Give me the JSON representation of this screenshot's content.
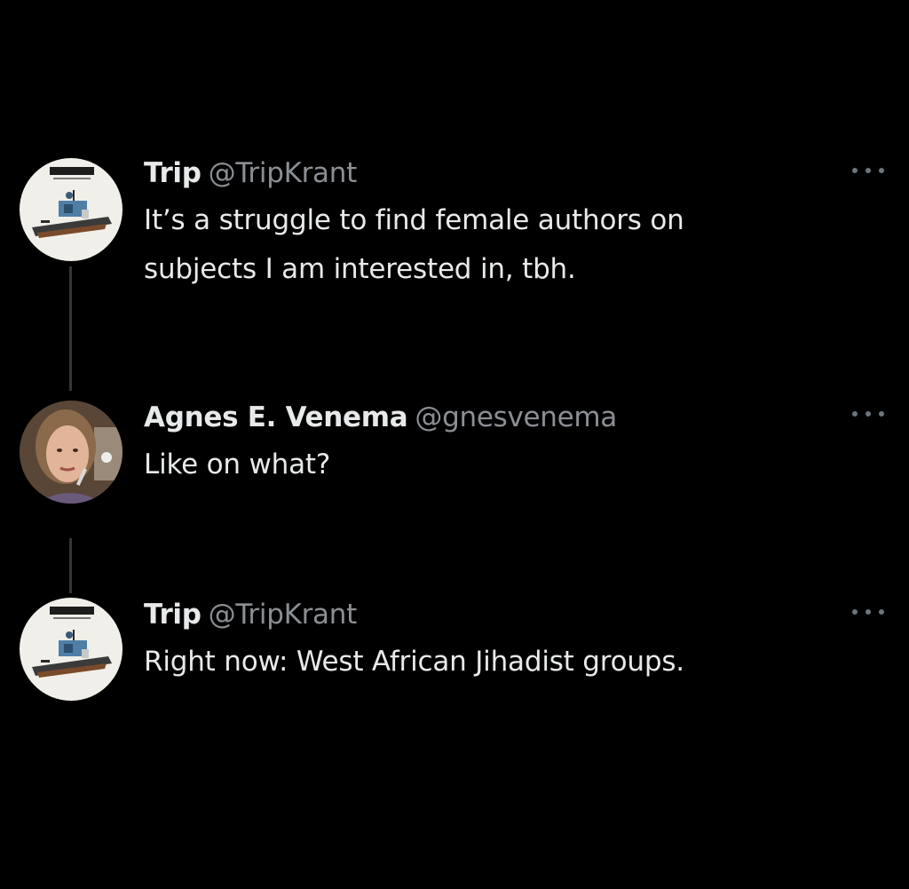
{
  "thread": {
    "tweets": [
      {
        "display_name": "Trip",
        "handle": "@TripKrant",
        "text": "It’s a struggle to find female authors on\nsubjects I am interested in, tbh.",
        "avatar": "book-cover-avatar",
        "more_icon": "more-dots-icon"
      },
      {
        "display_name": "Agnes E. Venema",
        "handle": "@gnesvenema",
        "text": "Like on what?",
        "avatar": "woman-portrait-avatar",
        "more_icon": "more-dots-icon"
      },
      {
        "display_name": "Trip",
        "handle": "@TripKrant",
        "text": "Right now: West African Jihadist groups.",
        "avatar": "book-cover-avatar",
        "more_icon": "more-dots-icon"
      }
    ]
  },
  "colors": {
    "background": "#000000",
    "primary_text": "#e7e9ea",
    "secondary_text": "#8b8f94",
    "connector": "#333639"
  }
}
